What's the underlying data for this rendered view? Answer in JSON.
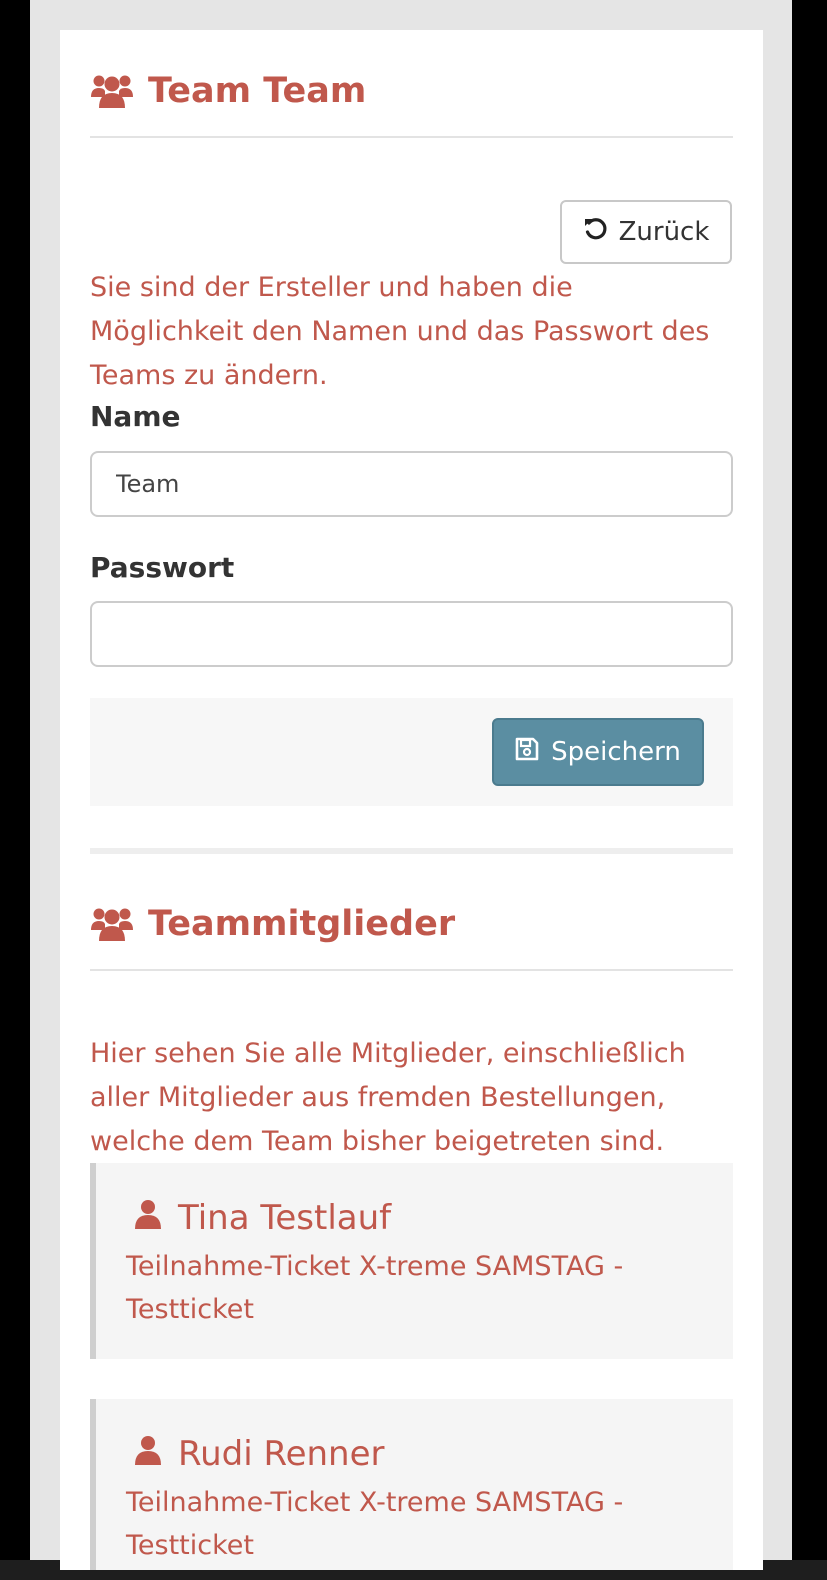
{
  "team_section": {
    "title": "Team Team",
    "back_button": "Zurück",
    "creator_info": "Sie sind der Ersteller und haben die Möglichkeit den Namen und das Passwort des Teams zu ändern.",
    "name_label": "Name",
    "name_value": "Team",
    "password_label": "Passwort",
    "password_value": "",
    "save_button": "Speichern"
  },
  "members_section": {
    "title": "Teammitglieder",
    "info": "Hier sehen Sie alle Mitglieder, einschließlich aller Mitglieder aus fremden Bestellungen, welche dem Team bisher beigetreten sind.",
    "members": [
      {
        "name": "Tina Testlauf",
        "ticket": "Teilnahme-Ticket X-treme SAMSTAG - Testticket"
      },
      {
        "name": "Rudi Renner",
        "ticket": "Teilnahme-Ticket X-treme SAMSTAG - Testticket"
      }
    ]
  },
  "colors": {
    "accent": "#c0584c",
    "primary_button": "#5b8ea2",
    "panel_background": "#f5f5f5"
  },
  "icons": {
    "team": "users-icon",
    "back": "undo-icon",
    "save": "floppy-disk-icon",
    "member": "user-icon"
  }
}
